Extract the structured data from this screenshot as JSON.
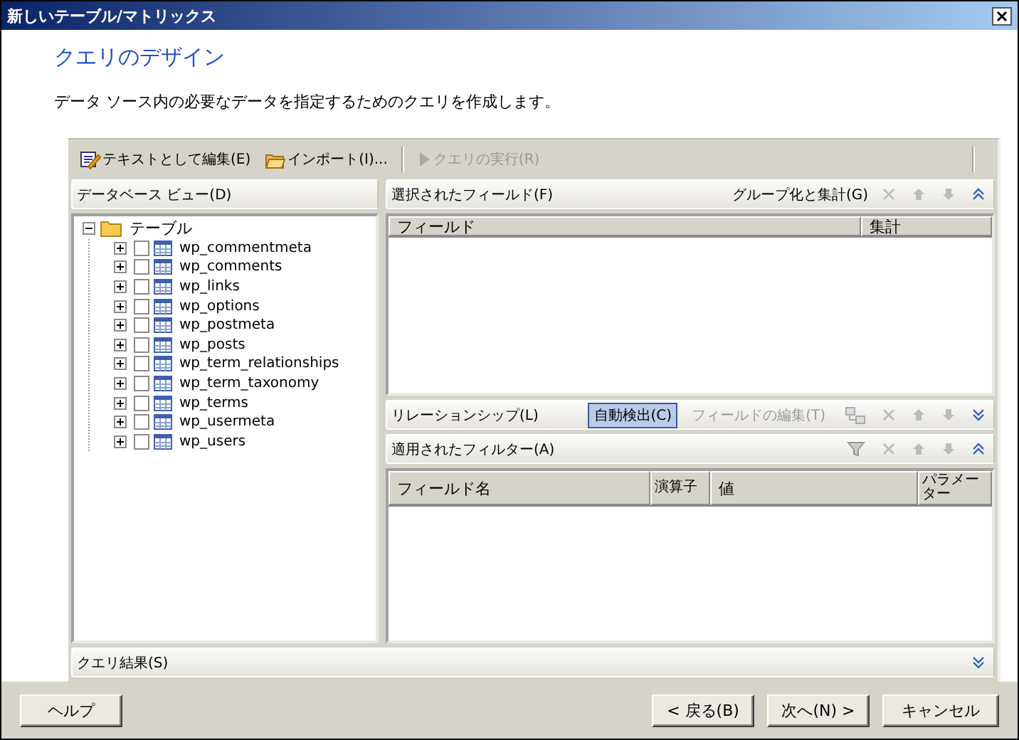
{
  "window": {
    "title": "新しいテーブル/マトリックス"
  },
  "header": {
    "title": "クエリのデザイン",
    "description": "データ ソース内の必要なデータを指定するためのクエリを作成します。"
  },
  "toolbar": [
    {
      "kind": "edit",
      "label": "テキストとして編集(E)",
      "disabled": false
    },
    {
      "kind": "import",
      "label": "インポート(I)...",
      "disabled": false
    },
    {
      "kind": "run",
      "label": "クエリの実行(R)",
      "disabled": true
    }
  ],
  "database_view": {
    "title": "データベース ビュー(D)",
    "tree": {
      "label": "テーブル",
      "expanded": true,
      "children": [
        {
          "label": "wp_commentmeta",
          "expanded": false,
          "checked": false
        },
        {
          "label": "wp_comments",
          "expanded": false,
          "checked": false
        },
        {
          "label": "wp_links",
          "expanded": false,
          "checked": false
        },
        {
          "label": "wp_options",
          "expanded": false,
          "checked": false
        },
        {
          "label": "wp_postmeta",
          "expanded": false,
          "checked": false
        },
        {
          "label": "wp_posts",
          "expanded": false,
          "checked": false
        },
        {
          "label": "wp_term_relationships",
          "expanded": false,
          "checked": false
        },
        {
          "label": "wp_term_taxonomy",
          "expanded": false,
          "checked": false
        },
        {
          "label": "wp_terms",
          "expanded": false,
          "checked": false
        },
        {
          "label": "wp_usermeta",
          "expanded": false,
          "checked": false
        },
        {
          "label": "wp_users",
          "expanded": false,
          "checked": false
        }
      ]
    }
  },
  "selected_fields": {
    "title": "選択されたフィールド(F)",
    "action": "グループ化と集計(G)",
    "expanded": true,
    "columns": [
      "フィールド",
      "集計"
    ]
  },
  "relationships": {
    "title": "リレーションシップ(L)",
    "expanded": false,
    "buttons": [
      {
        "label": "自動検出(C)",
        "pressed": true,
        "disabled": false
      },
      {
        "label": "フィールドの編集(T)",
        "pressed": false,
        "disabled": true
      }
    ]
  },
  "filters": {
    "title": "適用されたフィルター(A)",
    "expanded": true,
    "columns": [
      "フィールド名",
      "演算子",
      "値",
      "パラメーター"
    ]
  },
  "query_results": {
    "title": "クエリ結果(S)",
    "expanded": false
  },
  "buttons": [
    {
      "label": "ヘルプ"
    },
    {
      "label": "< 戻る(B)"
    },
    {
      "label": "次へ(N) >"
    },
    {
      "label": "キャンセル"
    }
  ]
}
